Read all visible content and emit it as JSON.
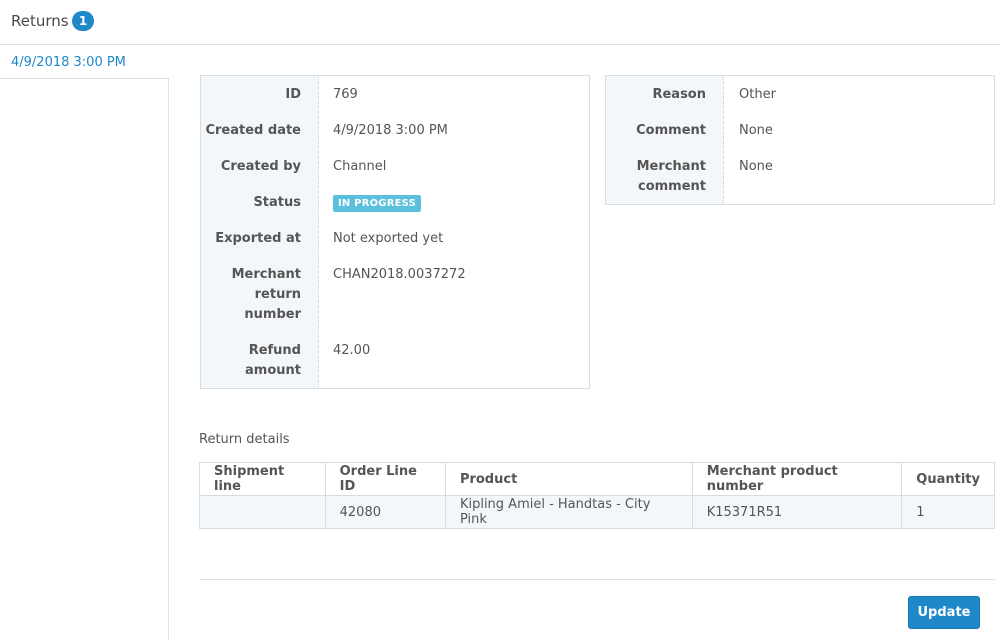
{
  "header": {
    "title": "Returns",
    "badge_count": "1"
  },
  "left": {
    "date_link": "4/9/2018 3:00 PM"
  },
  "main_info": {
    "rows": [
      {
        "label": "ID",
        "value": "769"
      },
      {
        "label": "Created date",
        "value": "4/9/2018 3:00 PM"
      },
      {
        "label": "Created by",
        "value": "Channel"
      },
      {
        "label": "Status",
        "value": "IN PROGRESS"
      },
      {
        "label": "Exported at",
        "value": "Not exported yet"
      },
      {
        "label_lines": [
          "Merchant",
          "return",
          "number"
        ],
        "value": "CHAN2018.0037272"
      },
      {
        "label_lines": [
          "Refund",
          "amount"
        ],
        "value": "42.00"
      }
    ]
  },
  "side_info": {
    "rows": [
      {
        "label": "Reason",
        "value": "Other"
      },
      {
        "label": "Comment",
        "value": "None"
      },
      {
        "label_lines": [
          "Merchant",
          "comment"
        ],
        "value": "None"
      }
    ]
  },
  "details": {
    "title": "Return details",
    "columns": [
      "Shipment line",
      "Order Line ID",
      "Product",
      "Merchant product number",
      "Quantity"
    ],
    "rows": [
      [
        "",
        "42080",
        "Kipling Amiel - Handtas - City Pink",
        "K15371R51",
        "1"
      ]
    ]
  },
  "actions": {
    "update_label": "Update"
  },
  "colors": {
    "accent": "#1e88c9",
    "status_in_progress": "#5bc0de"
  }
}
